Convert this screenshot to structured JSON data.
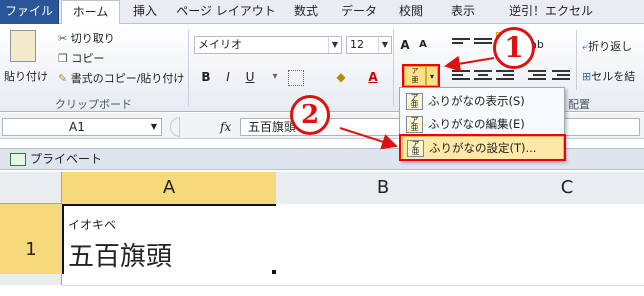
{
  "tabs": [
    {
      "label": "ファイル"
    },
    {
      "label": "ホーム"
    },
    {
      "label": "挿入"
    },
    {
      "label": "ページ レイアウト"
    },
    {
      "label": "数式"
    },
    {
      "label": "データ"
    },
    {
      "label": "校閲"
    },
    {
      "label": "表示"
    },
    {
      "label": "逆引！エクセル"
    }
  ],
  "clipboard": {
    "paste": "貼り付け",
    "cut": "切り取り",
    "copy": "コピー",
    "format_painter": "書式のコピー/貼り付け",
    "group_label": "クリップボード"
  },
  "font": {
    "name": "メイリオ",
    "size": "12",
    "bold": "B",
    "italic": "I",
    "underline": "U",
    "grow": "A",
    "shrink": "A"
  },
  "alignment": {
    "wrap": "折り返し",
    "merge": "セルを結",
    "group_label": "配置"
  },
  "furigana_menu": {
    "items": [
      {
        "label": "ふりがなの表示(S)"
      },
      {
        "label": "ふりがなの編集(E)"
      },
      {
        "label": "ふりがなの設定(T)..."
      }
    ]
  },
  "formula_bar": {
    "name_box": "A1",
    "fx": "fx",
    "value": "五百旗頭"
  },
  "workbook": {
    "title": "プライベート",
    "columns": [
      "A",
      "B",
      "C"
    ],
    "rows": [
      "1"
    ],
    "cell_a1_furigana": "イオキベ",
    "cell_a1_value": "五百旗頭"
  },
  "annotations": {
    "one": "1",
    "two": "2"
  },
  "colors": {
    "file_tab": "#2a5699",
    "selection": "#f6d97a",
    "highlight_menu": "#fde9a8",
    "callout": "#dd1111"
  }
}
